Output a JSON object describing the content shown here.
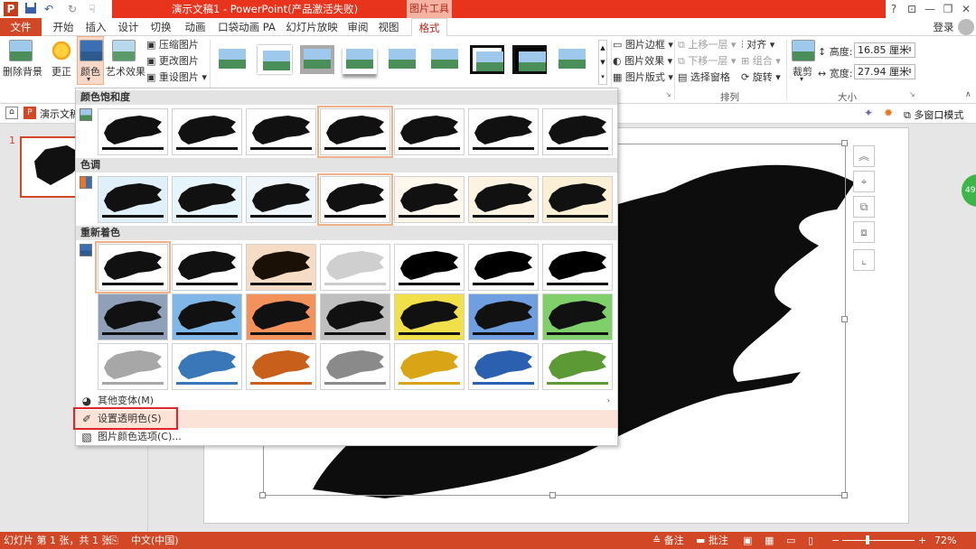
{
  "window": {
    "title": "演示文稿1 - PowerPoint(产品激活失败)",
    "context_tab_group": "图片工具",
    "help": "?",
    "ribbon_toggle": "⊡",
    "minimize": "—",
    "restore": "❐",
    "close": "✕"
  },
  "qat": {
    "app_icon": "P",
    "save_icon": "floppy-icon",
    "undo": "↶",
    "redo": "↻",
    "touch": "☟"
  },
  "tabs": [
    "文件",
    "开始",
    "插入",
    "设计",
    "切换",
    "动画",
    "口袋动画 PA",
    "幻灯片放映",
    "审阅",
    "视图",
    "格式"
  ],
  "login": "登录",
  "ribbon": {
    "remove_bg": "删除背景",
    "correct": "更正",
    "color": "颜色",
    "art_effect": "艺术效果",
    "compress": "压缩图片",
    "change": "更改图片",
    "reset": "重设图片",
    "pic_border": "图片边框",
    "pic_effect": "图片效果",
    "pic_layout": "图片版式",
    "bring_forward": "上移一层",
    "send_backward": "下移一层",
    "selection_pane": "选择窗格",
    "align": "对齐",
    "group": "组合",
    "rotate": "旋转",
    "crop": "裁剪",
    "height_label": "高度:",
    "height_value": "16.85 厘米",
    "width_label": "宽度:",
    "width_value": "27.94 厘米",
    "arrange_group": "排列",
    "size_group": "大小"
  },
  "subbar": {
    "file_name": "演示文稿",
    "multi_window": "多窗口模式"
  },
  "thumbs": {
    "slide_number": "1"
  },
  "dropdown": {
    "sec_saturation": "颜色饱和度",
    "sec_tone": "色调",
    "sec_recolor": "重新着色",
    "more_variants": "其他变体(M)",
    "set_transparent": "设置透明色(S)",
    "color_options": "图片颜色选项(C)..."
  },
  "side_badge": "49",
  "status": {
    "slide_info": "幻灯片 第 1 张，共 1 张",
    "language": "中文(中国)",
    "notes": "备注",
    "comments": "批注",
    "zoom": "72%"
  },
  "colors": {
    "accent": "#d24726",
    "title_red": "#e8331d",
    "highlight": "#e0262a"
  }
}
